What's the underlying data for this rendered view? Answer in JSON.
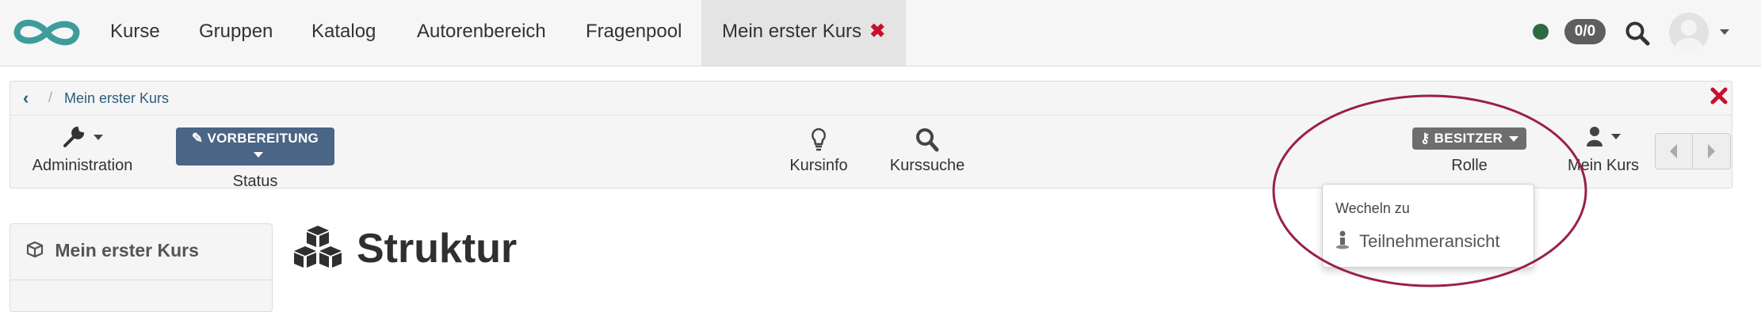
{
  "nav": {
    "items": [
      "Kurse",
      "Gruppen",
      "Katalog",
      "Autorenbereich",
      "Fragenpool"
    ],
    "active_tab": "Mein erster Kurs",
    "notification_count": "0/0",
    "online_color": "#2e6a3e"
  },
  "breadcrumb": {
    "course": "Mein erster Kurs"
  },
  "toolbar": {
    "administration": "Administration",
    "status_badge": "VORBEREITUNG",
    "status_label": "Status",
    "kursinfo": "Kursinfo",
    "kurssuche": "Kurssuche",
    "role_badge": "BESITZER",
    "role_label": "Rolle",
    "my_course": "Mein Kurs"
  },
  "role_dropdown": {
    "header": "Wecheln zu",
    "item": "Teilnehmeransicht"
  },
  "left_menu": {
    "title": "Mein erster Kurs"
  },
  "main": {
    "title": "Struktur"
  },
  "colors": {
    "accent": "#2a5d7c",
    "status_badge": "#4a6585",
    "role_badge": "#6e6e6e",
    "close": "#c8102e",
    "highlight": "#9b1f4a"
  }
}
